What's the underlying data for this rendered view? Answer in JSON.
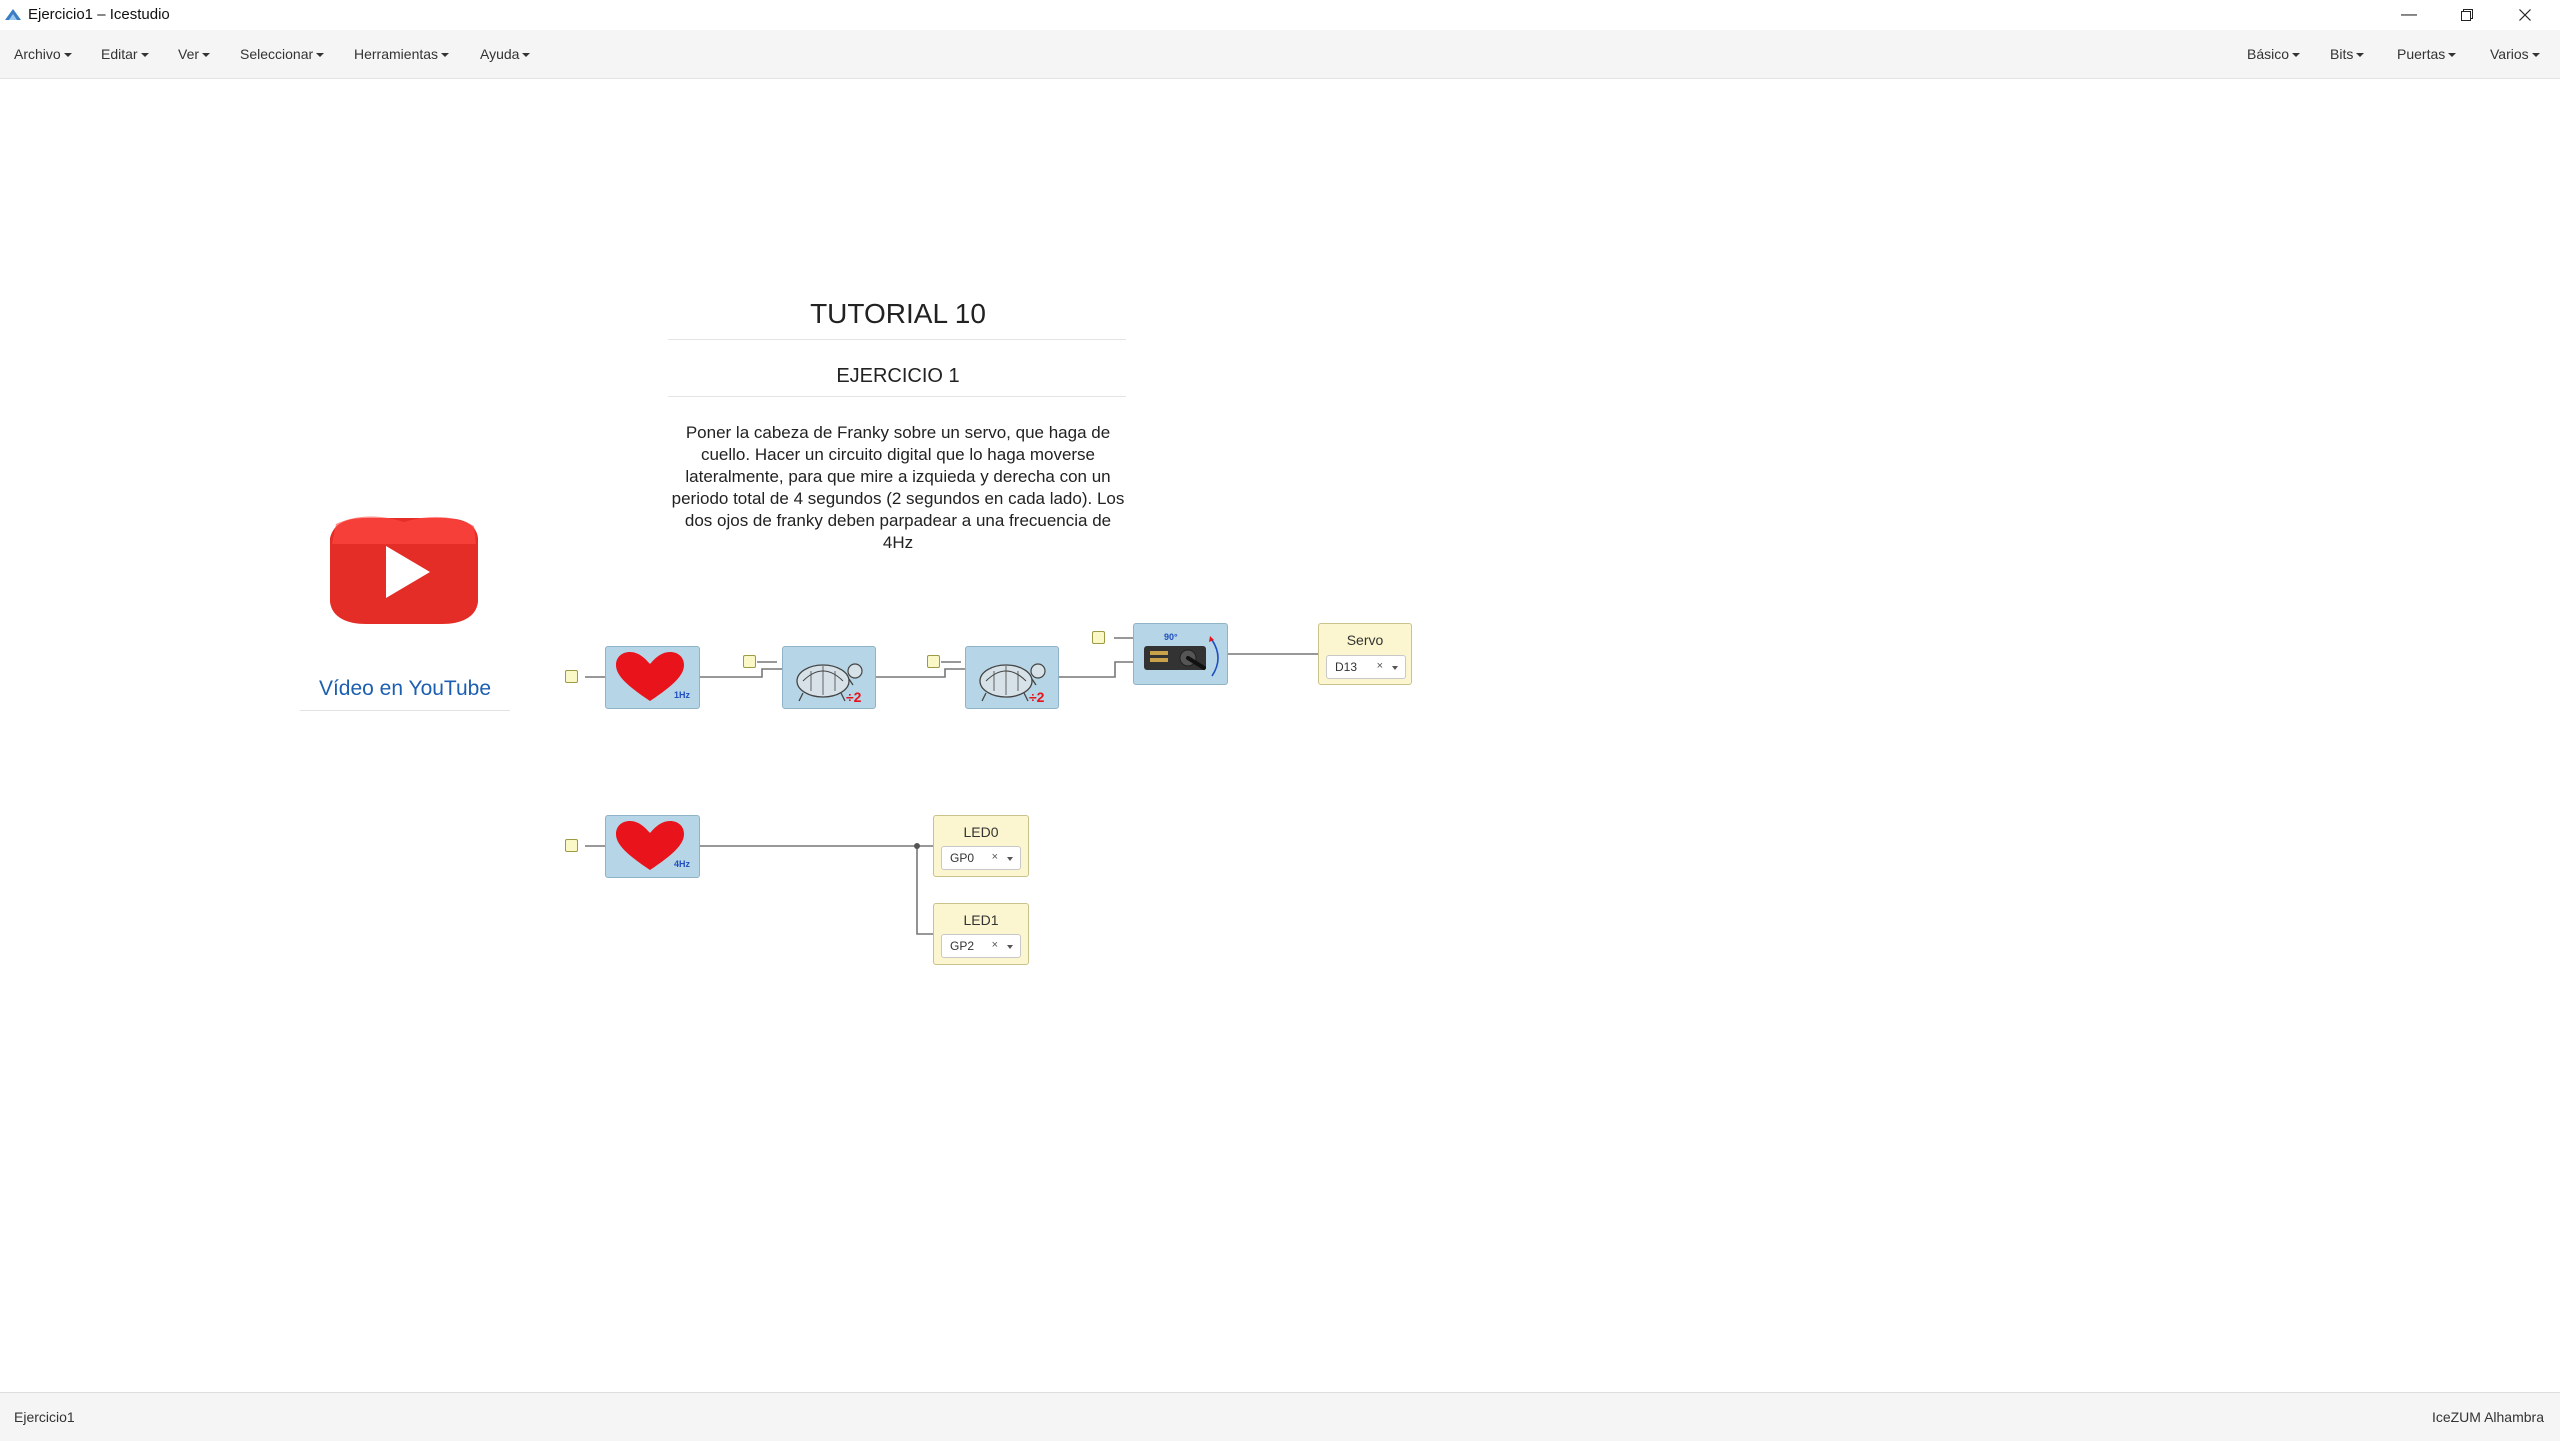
{
  "window": {
    "title": "Ejercicio1 – Icestudio",
    "controls": [
      "minimize-icon",
      "restore-icon",
      "close-icon"
    ]
  },
  "menubar": {
    "left": [
      {
        "label": "Archivo"
      },
      {
        "label": "Editar"
      },
      {
        "label": "Ver"
      },
      {
        "label": "Seleccionar"
      },
      {
        "label": "Herramientas"
      },
      {
        "label": "Ayuda"
      }
    ],
    "right": [
      {
        "label": "Básico"
      },
      {
        "label": "Bits"
      },
      {
        "label": "Puertas"
      },
      {
        "label": "Varios"
      }
    ]
  },
  "canvas": {
    "title": "TUTORIAL 10",
    "subtitle": "EJERCICIO 1",
    "description": "Poner la cabeza de Franky sobre un servo, que haga de cuello. Hacer un circuito digital que lo haga moverse lateralmente, para que mire a izquieda y derecha con un periodo total de 4 segundos (2 segundos en cada lado). Los dos ojos de franky deben parpadear a una frecuencia de 4Hz",
    "youtube_link": "Vídeo en YouTube",
    "blocks": {
      "heart_1hz_label": "1Hz",
      "heart_4hz_label": "4Hz",
      "divider_label": "÷2",
      "servo_angle_label": "90°",
      "servo": {
        "label": "Servo",
        "pin": "D13"
      },
      "led0": {
        "label": "LED0",
        "pin": "GP0"
      },
      "led1": {
        "label": "LED1",
        "pin": "GP2"
      },
      "pin_clear": "×"
    }
  },
  "statusbar": {
    "left": "Ejercicio1",
    "right": "IceZUM Alhambra"
  },
  "colors": {
    "block_fill": "#b6d5e6",
    "io_fill": "#fbf6cf",
    "heart": "#e8131b",
    "youtube_red": "#e52d27",
    "link_blue": "#1c5fb0"
  }
}
